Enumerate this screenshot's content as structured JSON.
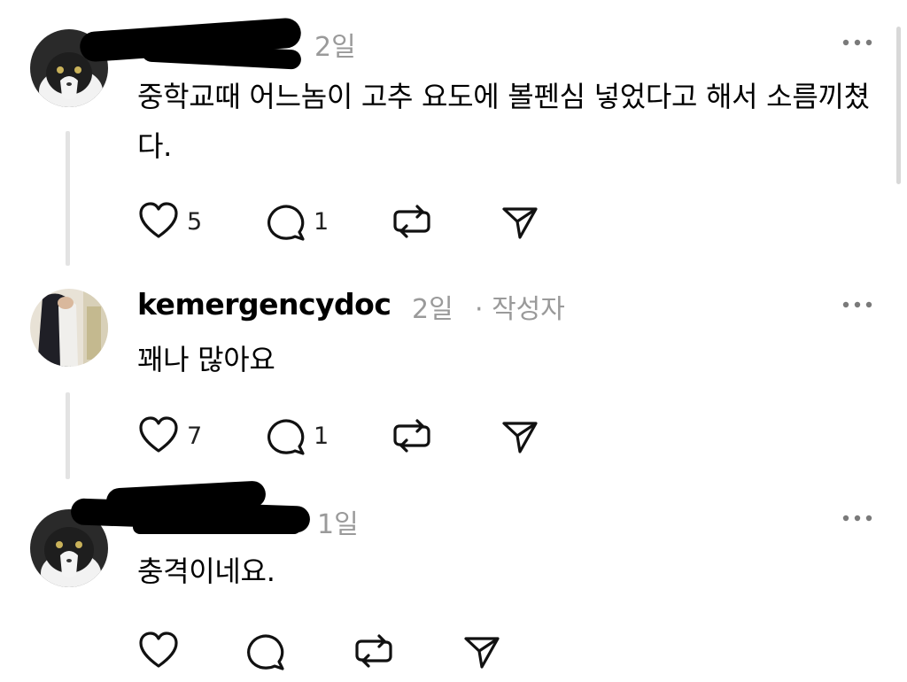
{
  "comments": [
    {
      "username": "",
      "time": "2일",
      "text": "중학교때 어느놈이 고추 요도에 볼펜심 넣었다고 해서 소름끼쳤다.",
      "likes": "5",
      "replies": "1",
      "avatar": "cat-avatar"
    },
    {
      "username": "kemergencydoc",
      "time": "2일",
      "role": "· 작성자",
      "text": "꽤나 많아요",
      "likes": "7",
      "replies": "1",
      "avatar": "person-avatar"
    },
    {
      "username": "",
      "time": "1일",
      "text": "충격이네요.",
      "likes": "",
      "replies": "",
      "avatar": "cat-avatar"
    }
  ],
  "icons": {
    "like": "heart-icon",
    "reply": "comment-bubble-icon",
    "repost": "repost-icon",
    "share": "send-icon",
    "more": "more-options-icon"
  },
  "colors": {
    "secondary_text": "#9a9a9a",
    "thread_line": "#e3e3e3"
  }
}
